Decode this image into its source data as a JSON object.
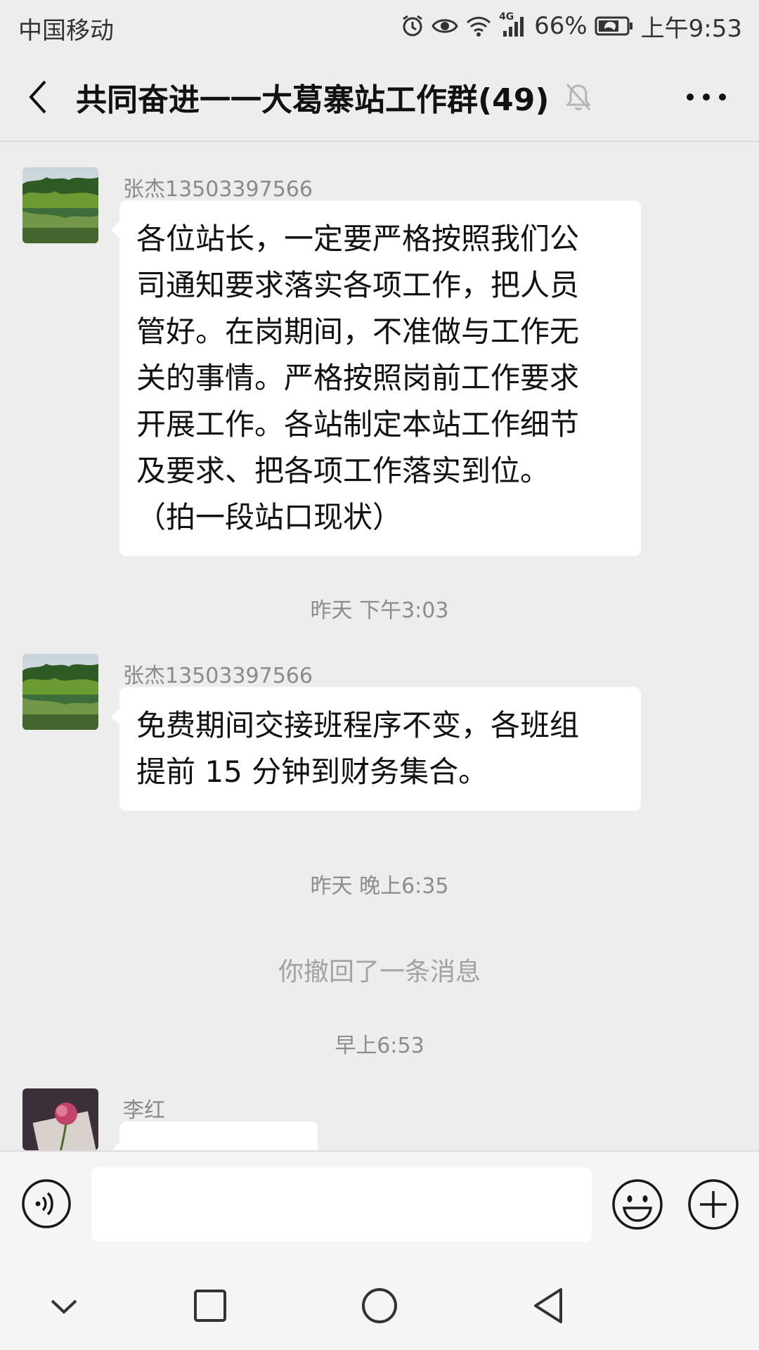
{
  "status_bar": {
    "carrier": "中国移动",
    "network": "4G",
    "battery": "66%",
    "time": "上午9:53",
    "icons": [
      "alarm-icon",
      "eye-icon",
      "wifi-icon",
      "signal-icon",
      "battery-icon"
    ]
  },
  "header": {
    "title": "共同奋进一一大葛寨站工作群(49)",
    "icons": [
      "back-icon",
      "mute-bell-icon",
      "more-icon"
    ]
  },
  "messages": [
    {
      "sender": "张杰13503397566",
      "text_lines": [
        "各位站长，一定要严格按照我们公",
        "司通知要求落实各项工作，把人员",
        "管好。在岗期间，不准做与工作无",
        "关的事情。严格按照岗前工作要求",
        "开展工作。各站制定本站工作细节",
        "及要求、把各项工作落实到位。",
        "（拍一段站口现状）"
      ]
    },
    {
      "timestamp": "昨天 下午3:03"
    },
    {
      "sender": "张杰13503397566",
      "text_lines": [
        "免费期间交接班程序不变，各班组",
        "提前 15 分钟到财务集合。"
      ]
    },
    {
      "timestamp": "昨天 晚上6:35"
    },
    {
      "system": "你撤回了一条消息"
    },
    {
      "timestamp": "早上6:53"
    },
    {
      "sender": "李红"
    }
  ],
  "input_bar": {
    "value": "",
    "icons": [
      "voice-icon",
      "emoji-icon",
      "plus-icon"
    ]
  },
  "nav_bar": {
    "icons": [
      "nav-down-icon",
      "nav-recent-icon",
      "nav-home-icon",
      "nav-back-icon"
    ]
  },
  "colors": {
    "background": "#ededed",
    "bubble": "#ffffff",
    "meta_text": "#8c8c8c"
  }
}
